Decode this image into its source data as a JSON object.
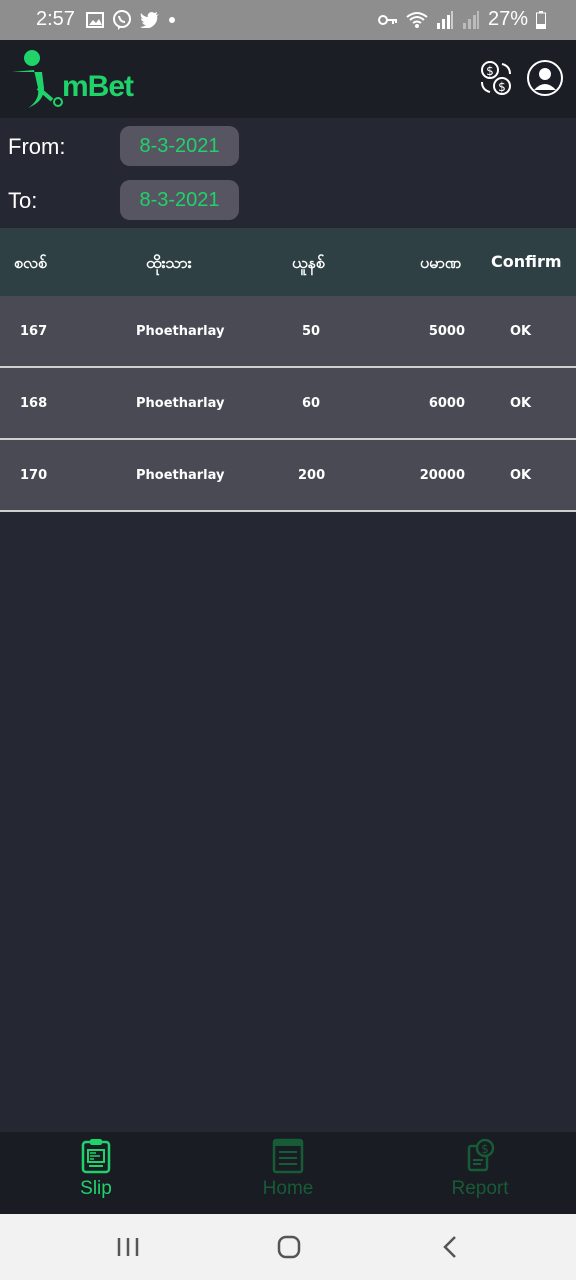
{
  "status_bar": {
    "time": "2:57",
    "battery": "27%"
  },
  "app": {
    "logo_text": "mBet"
  },
  "filters": {
    "from_label": "From:",
    "from_value": "8-3-2021",
    "to_label": "To:",
    "to_value": "8-3-2021"
  },
  "table": {
    "headers": [
      "စလစ်",
      "ထိုးသား",
      "ယူနစ်",
      "ပမာဏ",
      "Confirm"
    ],
    "rows": [
      {
        "slip": "167",
        "name": "Phoetharlay",
        "unit": "50",
        "amount": "5000",
        "confirm": "OK"
      },
      {
        "slip": "168",
        "name": "Phoetharlay",
        "unit": "60",
        "amount": "6000",
        "confirm": "OK"
      },
      {
        "slip": "170",
        "name": "Phoetharlay",
        "unit": "200",
        "amount": "20000",
        "confirm": "OK"
      }
    ]
  },
  "bottom_nav": {
    "items": [
      {
        "label": "Slip",
        "icon": "clipboard-icon",
        "active": true
      },
      {
        "label": "Home",
        "icon": "document-list-icon",
        "active": false
      },
      {
        "label": "Report",
        "icon": "money-report-icon",
        "active": false
      }
    ]
  },
  "colors": {
    "accent": "#1fd36a",
    "background": "#252832",
    "header_bg": "#1b1e25",
    "table_header_bg": "#2f4044",
    "row_bg": "#4a4a54"
  }
}
